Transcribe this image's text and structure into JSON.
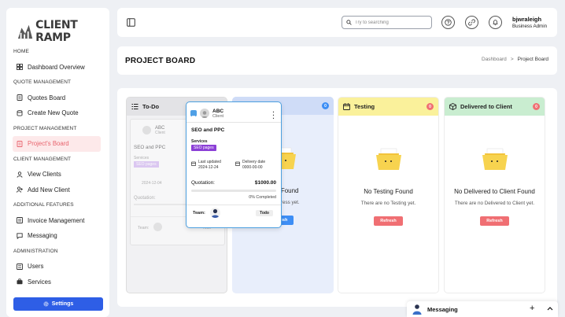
{
  "app": {
    "logo_text": "CLIENT RAMP"
  },
  "sidebar": {
    "sections": [
      {
        "title": "HOME",
        "items": [
          {
            "label": "Dashboard Overview",
            "icon": "grid-icon"
          }
        ]
      },
      {
        "title": "QUOTE MANAGEMENT",
        "items": [
          {
            "label": "Quotes Board",
            "icon": "document-icon"
          },
          {
            "label": "Create New Quote",
            "icon": "database-icon"
          }
        ]
      },
      {
        "title": "PROJECT MANAGEMENT",
        "items": [
          {
            "label": "Project's Board",
            "icon": "document-icon",
            "active": true
          }
        ]
      },
      {
        "title": "CLIENT MANAGEMENT",
        "items": [
          {
            "label": "View Clients",
            "icon": "user-icon"
          },
          {
            "label": "Add New Client",
            "icon": "user-plus-icon"
          }
        ]
      },
      {
        "title": "ADDITIONAL FEATURES",
        "items": [
          {
            "label": "Invoice Management",
            "icon": "invoice-icon"
          },
          {
            "label": "Messaging",
            "icon": "chat-icon"
          }
        ]
      },
      {
        "title": "ADMINISTRATION",
        "items": [
          {
            "label": "Users",
            "icon": "list-icon"
          },
          {
            "label": "Services",
            "icon": "briefcase-icon"
          }
        ]
      }
    ],
    "settings_label": "Settings"
  },
  "header": {
    "search_placeholder": "Try to searching",
    "user_name": "bjwraleigh",
    "user_role": "Business Admin"
  },
  "page": {
    "title": "PROJECT BOARD",
    "breadcrumb": [
      "Dashboard",
      ">",
      "Project Board"
    ]
  },
  "board": {
    "columns": [
      {
        "key": "todo",
        "title": "To-Do"
      },
      {
        "key": "progress",
        "title": "",
        "count": "0",
        "empty_title": "ress Found",
        "empty_sub": "n Progress yet.",
        "refresh": "resh"
      },
      {
        "key": "testing",
        "title": "Testing",
        "count": "0",
        "empty_title": "No Testing Found",
        "empty_sub": "There are no Testing yet.",
        "refresh": "Refresh"
      },
      {
        "key": "delivered",
        "title": "Delivered to Client",
        "count": "0",
        "empty_title": "No Delivered to Client Found",
        "empty_sub": "There are no Delivered to Client yet.",
        "refresh": "Refresh"
      }
    ],
    "ghost_card": {
      "client_name": "ABC",
      "client_role": "Client",
      "title": "SEO and PPC",
      "services_label": "Services",
      "service_tag": "SEO pages",
      "last_updated": "2024-12-04",
      "quotation_label": "Quotation:",
      "team_label": "Team:",
      "status": "Todo"
    },
    "card": {
      "client_name": "ABC",
      "client_role": "Client",
      "title": "SEO and PPC",
      "services_label": "Services",
      "service_tag": "SEO pages",
      "last_updated_label": "Last updated",
      "last_updated": "2024-12-24",
      "delivery_label": "Delivery date",
      "delivery_date": "0000-00-00",
      "quotation_label": "Quotation:",
      "quotation_value": "$1000.00",
      "progress": 0,
      "progress_text": "0% Completed",
      "team_label": "Team:",
      "status": "Todo"
    }
  },
  "messaging": {
    "title": "Messaging"
  },
  "colors": {
    "primary": "#2e5ee6",
    "active_bg": "#fde9ea",
    "active_text": "#e8636d",
    "accent_card": "#4ca0e0",
    "service_tag": "#8b3fd6",
    "badge": "#f06f73",
    "badge_blue": "#3d8ef5"
  }
}
